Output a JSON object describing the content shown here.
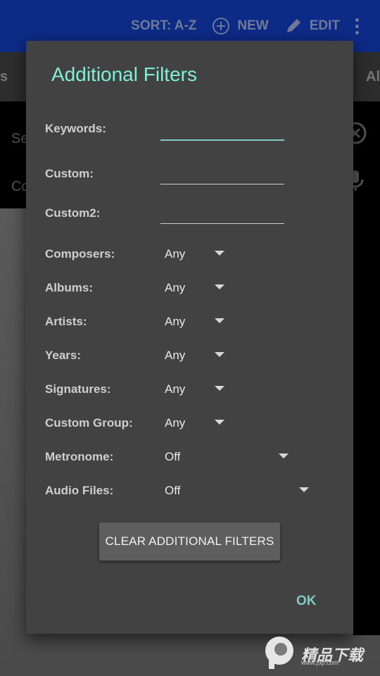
{
  "appbar": {
    "sort_label": "SORT: A-Z",
    "new_label": "NEW",
    "edit_label": "EDIT"
  },
  "tabs": {
    "left_fragment": "s",
    "right_fragment": "Al"
  },
  "search": {
    "line1_fragment": "Se",
    "line2_fragment": "Co"
  },
  "dialog": {
    "title": "Additional Filters",
    "text_fields": [
      {
        "label": "Keywords:",
        "value": ""
      },
      {
        "label": "Custom:",
        "value": ""
      },
      {
        "label": "Custom2:",
        "value": ""
      }
    ],
    "dropdowns": [
      {
        "label": "Composers:",
        "value": "Any"
      },
      {
        "label": "Albums:",
        "value": "Any"
      },
      {
        "label": "Artists:",
        "value": "Any"
      },
      {
        "label": "Years:",
        "value": "Any"
      },
      {
        "label": "Signatures:",
        "value": "Any"
      },
      {
        "label": "Custom Group:",
        "value": "Any"
      },
      {
        "label": "Metronome:",
        "value": "Off"
      },
      {
        "label": "Audio Files:",
        "value": "Off"
      }
    ],
    "clear_button": "CLEAR ADDITIONAL FILTERS",
    "ok_button": "OK"
  },
  "watermark": {
    "text": "精品下载",
    "sub": "www.j9p.com"
  },
  "colors": {
    "accent": "#80cbc4",
    "title": "#7ff0d6",
    "dialog_bg": "#424242",
    "appbar": "#0d2a86"
  }
}
